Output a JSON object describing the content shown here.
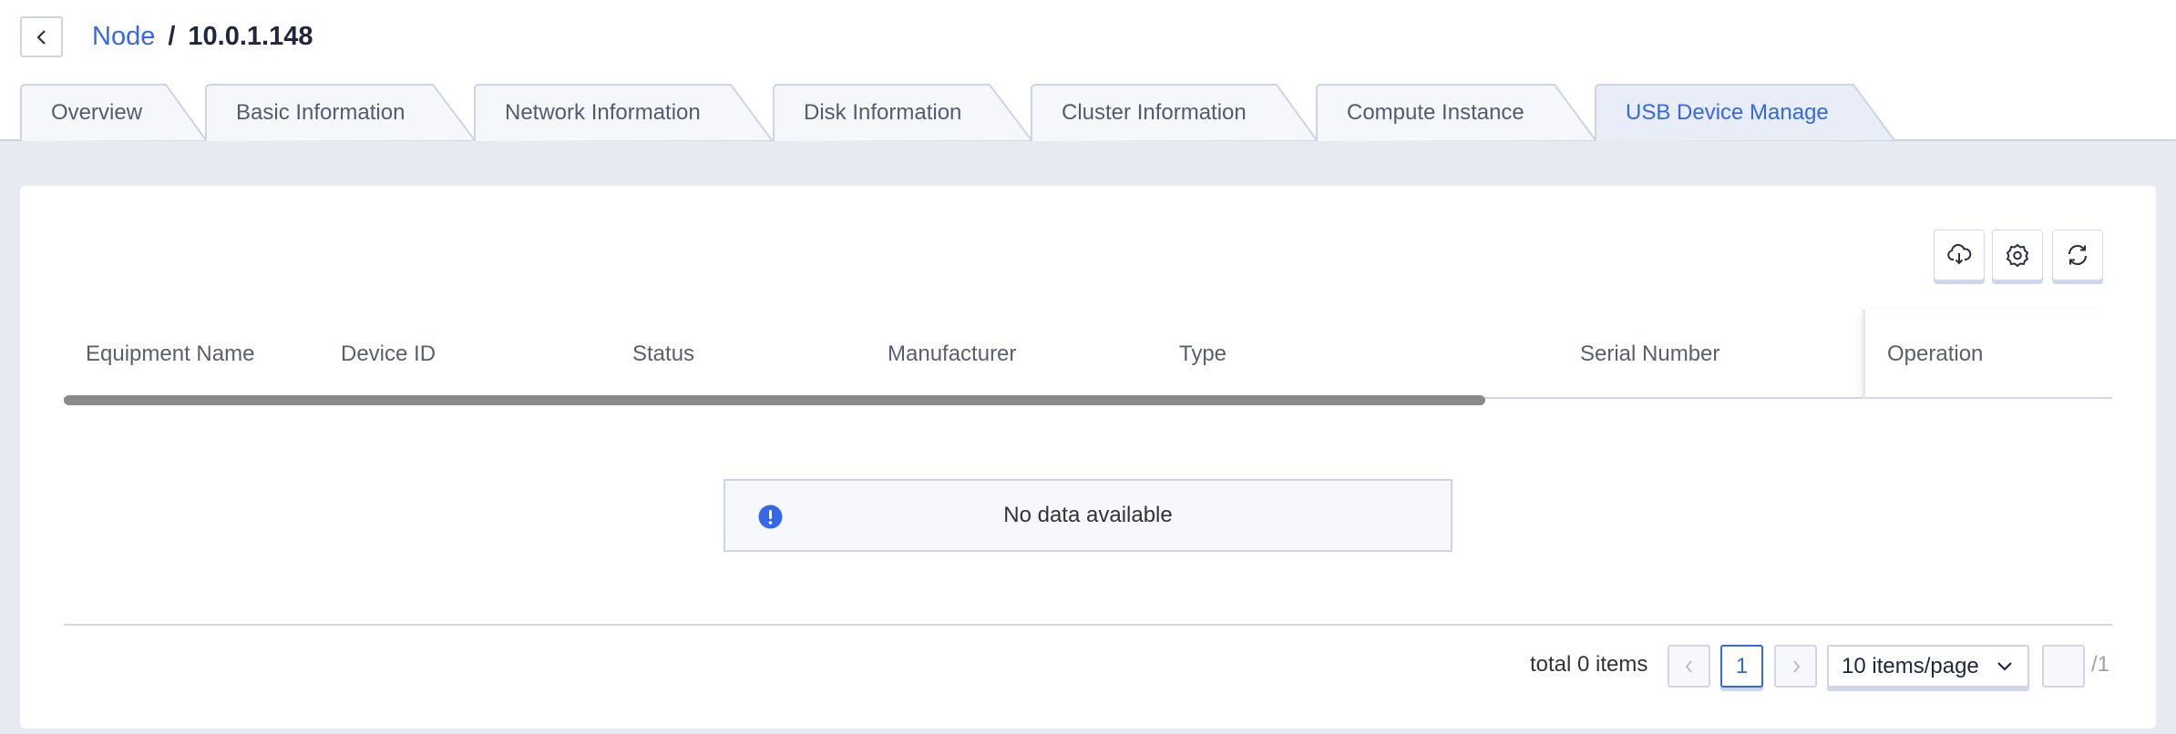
{
  "breadcrumb": {
    "parent": "Node",
    "separator": "/",
    "current": "10.0.1.148"
  },
  "tabs": [
    {
      "label": "Overview",
      "active": false
    },
    {
      "label": "Basic Information",
      "active": false
    },
    {
      "label": "Network Information",
      "active": false
    },
    {
      "label": "Disk Information",
      "active": false
    },
    {
      "label": "Cluster Information",
      "active": false
    },
    {
      "label": "Compute Instance",
      "active": false
    },
    {
      "label": "USB Device Manage",
      "active": true
    }
  ],
  "toolbar": {
    "icons": [
      "cloud-download-icon",
      "gear-icon",
      "refresh-icon"
    ]
  },
  "table": {
    "columns": [
      "Equipment Name",
      "Device ID",
      "Status",
      "Manufacturer",
      "Type",
      "Serial Number",
      "Operation"
    ],
    "rows": [],
    "empty_text": "No data available"
  },
  "pagination": {
    "total_text": "total 0 items",
    "current_page": "1",
    "page_size": "10 items/page",
    "jump_value": "",
    "total_pages": "/1"
  },
  "colors": {
    "accent": "#3468e8",
    "background": "#e8eaf2",
    "border": "#cfd3e3"
  }
}
